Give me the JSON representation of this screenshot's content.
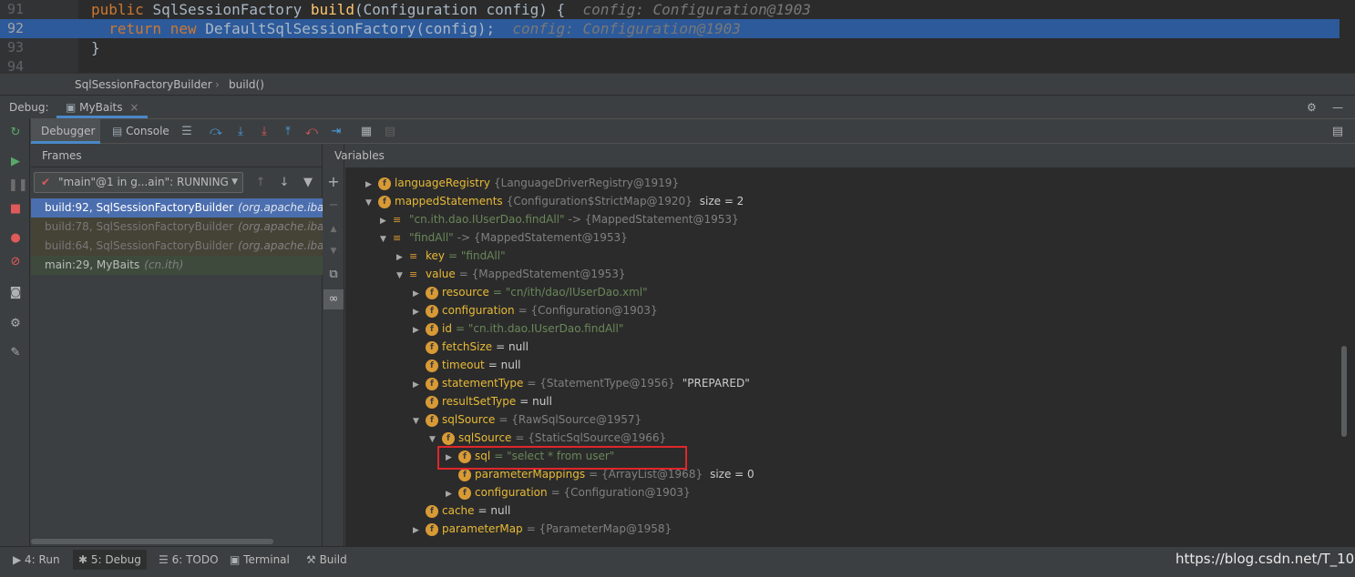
{
  "editor": {
    "lines": [
      {
        "num": "91",
        "code_parts": [
          {
            "t": "public ",
            "c": "kw"
          },
          {
            "t": "SqlSessionFactory ",
            "c": "pl"
          },
          {
            "t": "build",
            "c": "fn"
          },
          {
            "t": "(Configuration config) {  ",
            "c": "pl"
          },
          {
            "t": "config: Configuration@1903",
            "c": "cm"
          }
        ]
      },
      {
        "num": "92",
        "code_parts": [
          {
            "t": "  return new ",
            "c": "kw"
          },
          {
            "t": "DefaultSqlSessionFactory(config);  ",
            "c": "pl"
          },
          {
            "t": "config: Configuration@1903",
            "c": "cm"
          }
        ]
      },
      {
        "num": "93",
        "code_parts": [
          {
            "t": "}",
            "c": "pl"
          }
        ]
      },
      {
        "num": "94",
        "code_parts": []
      }
    ]
  },
  "breadcrumb": {
    "class_name": "SqlSessionFactoryBuilder",
    "method": "build()"
  },
  "debug_bar": {
    "label": "Debug:",
    "run_config": "MyBaits"
  },
  "debugger_tabs": {
    "debugger": "Debugger",
    "console": "Console"
  },
  "frames": {
    "header": "Frames",
    "thread": "\"main\"@1 in g...ain\": RUNNING",
    "items": [
      {
        "method": "build:92, SqlSessionFactoryBuilder",
        "pkg": "(org.apache.ibatis"
      },
      {
        "method": "build:78, SqlSessionFactoryBuilder",
        "pkg": "(org.apache.ibatis"
      },
      {
        "method": "build:64, SqlSessionFactoryBuilder",
        "pkg": "(org.apache.ibatis"
      },
      {
        "method": "main:29, MyBaits",
        "pkg": "(cn.ith)"
      }
    ]
  },
  "variables": {
    "header": "Variables",
    "rows": [
      {
        "name": "languageRegistry",
        "val": "{LanguageDriverRegistry@1919}",
        "extra": ""
      },
      {
        "name": "mappedStatements",
        "val": "{Configuration$StrictMap@1920}",
        "extra": "size = 2"
      },
      {
        "name": "\"cn.ith.dao.IUserDao.findAll\"",
        "val": "-> {MappedStatement@1953}",
        "extra": ""
      },
      {
        "name": "\"findAll\"",
        "val": "-> {MappedStatement@1953}",
        "extra": ""
      },
      {
        "name": "key",
        "val": "= \"findAll\"",
        "extra": ""
      },
      {
        "name": "value",
        "val": "= {MappedStatement@1953}",
        "extra": ""
      },
      {
        "name": "resource",
        "val": "= \"cn/ith/dao/IUserDao.xml\"",
        "extra": ""
      },
      {
        "name": "configuration",
        "val": "= {Configuration@1903}",
        "extra": ""
      },
      {
        "name": "id",
        "val": "= \"cn.ith.dao.IUserDao.findAll\"",
        "extra": ""
      },
      {
        "name": "fetchSize",
        "val": "= null",
        "extra": ""
      },
      {
        "name": "timeout",
        "val": "= null",
        "extra": ""
      },
      {
        "name": "statementType",
        "val": "= {StatementType@1956}",
        "extra": "\"PREPARED\""
      },
      {
        "name": "resultSetType",
        "val": "= null",
        "extra": ""
      },
      {
        "name": "sqlSource",
        "val": "= {RawSqlSource@1957}",
        "extra": ""
      },
      {
        "name": "sqlSource",
        "val": "= {StaticSqlSource@1966}",
        "extra": ""
      },
      {
        "name": "sql",
        "val": "= \"select * from user\"",
        "extra": ""
      },
      {
        "name": "parameterMappings",
        "val": "= {ArrayList@1968}",
        "extra": "size = 0"
      },
      {
        "name": "configuration",
        "val": "= {Configuration@1903}",
        "extra": ""
      },
      {
        "name": "cache",
        "val": "= null",
        "extra": ""
      },
      {
        "name": "parameterMap",
        "val": "= {ParameterMap@1958}",
        "extra": ""
      }
    ]
  },
  "bottom_tabs": {
    "run": "4: Run",
    "debug": "5: Debug",
    "todo": "6: TODO",
    "terminal": "Terminal",
    "build": "Build"
  },
  "watermark": "https://blog.csdn.net/T_10"
}
